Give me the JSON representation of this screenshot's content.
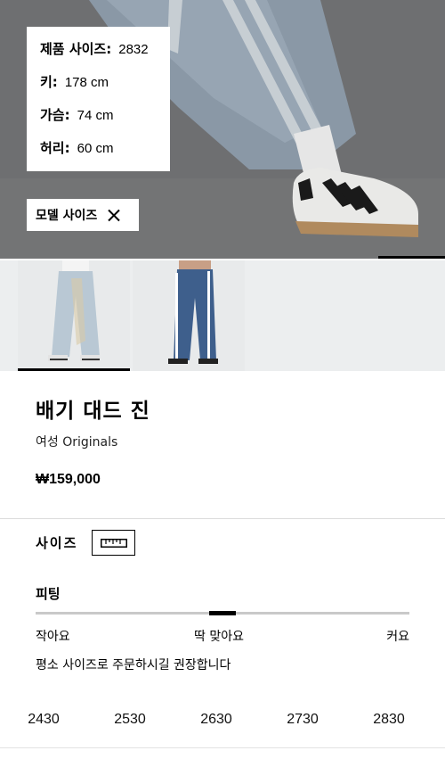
{
  "model_info": {
    "rows": [
      {
        "key": "제품 사이즈:",
        "value": "2832"
      },
      {
        "key": "키:",
        "value": "178 cm"
      },
      {
        "key": "가슴:",
        "value": "74 cm"
      },
      {
        "key": "허리:",
        "value": "60 cm"
      }
    ],
    "toggle_label": "모델 사이즈"
  },
  "product": {
    "title": "배기 대드 진",
    "category": "여성 Originals",
    "price": "₩159,000"
  },
  "size_section": {
    "label": "사이즈",
    "ruler_icon": "ruler-icon"
  },
  "fit": {
    "label": "피팅",
    "low": "작아요",
    "mid": "딱 맞아요",
    "high": "커요",
    "value_fraction": 0.5,
    "note": "평소 사이즈로 주문하시길 권장합니다"
  },
  "sizes": [
    "2430",
    "2530",
    "2630",
    "2730",
    "2830"
  ],
  "gallery": {
    "active_index": 0,
    "count": 2
  }
}
